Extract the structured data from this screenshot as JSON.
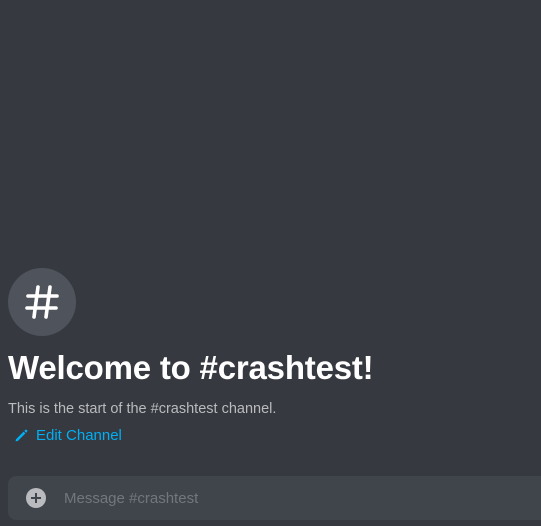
{
  "channel": {
    "name": "crashtest",
    "avatar_icon": "hashtag-icon"
  },
  "welcome": {
    "title": "Welcome to #crashtest!",
    "subtitle": "This is the start of the #crashtest channel."
  },
  "actions": {
    "edit_channel_label": "Edit Channel",
    "edit_channel_icon": "pencil-icon"
  },
  "composer": {
    "placeholder": "Message #crashtest",
    "value": "",
    "attach_icon": "plus-circle-icon"
  },
  "colors": {
    "background": "#36393f",
    "avatar_background": "#4f545c",
    "link": "#00aff4",
    "composer_background": "#40444b",
    "title_text": "#ffffff",
    "muted_text": "#b9bbbe",
    "placeholder_text": "#72767d"
  }
}
